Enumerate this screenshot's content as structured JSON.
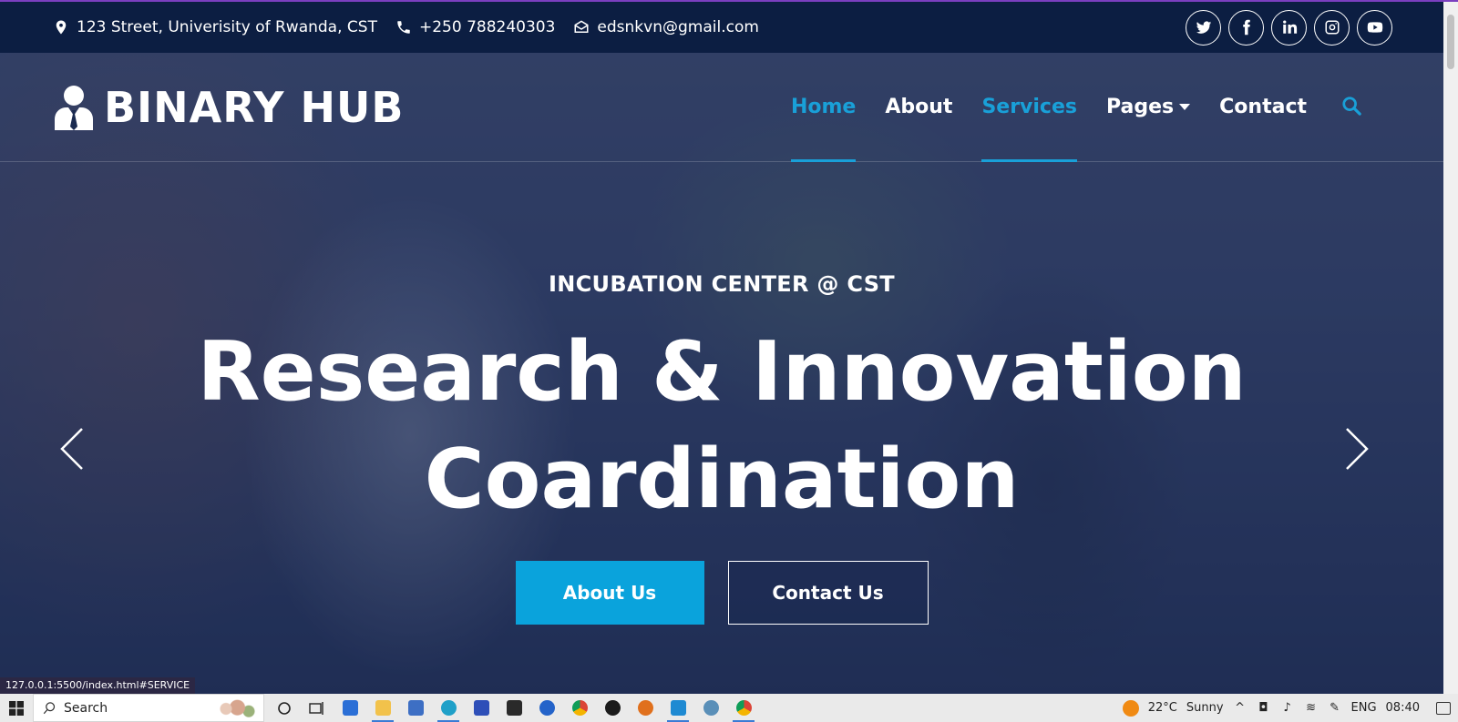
{
  "topbar": {
    "address": "123 Street, Univerisity of Rwanda, CST",
    "phone": "+250 788240303",
    "email": "edsnkvn@gmail.com",
    "socials": [
      "twitter-icon",
      "facebook-icon",
      "linkedin-icon",
      "instagram-icon",
      "youtube-icon"
    ]
  },
  "brand": {
    "name": "BINARY HUB"
  },
  "nav": {
    "items": [
      {
        "label": "Home",
        "active": true
      },
      {
        "label": "About",
        "active": false
      },
      {
        "label": "Services",
        "active": true
      },
      {
        "label": "Pages",
        "dropdown": true
      },
      {
        "label": "Contact",
        "active": false
      }
    ]
  },
  "hero": {
    "kicker": "INCUBATION CENTER @ CST",
    "headline_line1": "Research & Innovation",
    "headline_line2": "Coardination",
    "primary_button": "About Us",
    "secondary_button": "Contact Us"
  },
  "status_url": "127.0.0.1:5500/index.html#SERVICE",
  "taskbar": {
    "search_placeholder": "Search",
    "weather_temp": "22°C",
    "weather_text": "Sunny",
    "language": "ENG",
    "time": "08:40"
  },
  "colors": {
    "accent": "#19a0d8",
    "topbar": "#0c1e42",
    "primary_button": "#0aa3dc"
  }
}
